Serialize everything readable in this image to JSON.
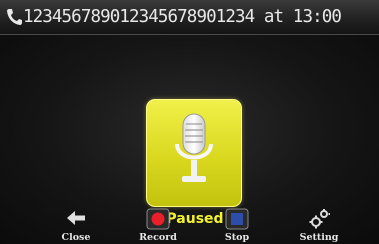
{
  "header": {
    "call_info": "12345678901234567890​1234 at 13:00",
    "phone_icon": "phone-icon"
  },
  "status": {
    "text": "Paused",
    "mic_icon": "microphone-icon",
    "color": "#f2f22e"
  },
  "toolbar": {
    "close_label": "Close",
    "record_label": "Record",
    "stop_label": "Stop",
    "setting_label": "Setting"
  },
  "colors": {
    "accent_yellow": "#e3e228",
    "record_red": "#e8202a",
    "stop_blue": "#2c4ea8"
  }
}
